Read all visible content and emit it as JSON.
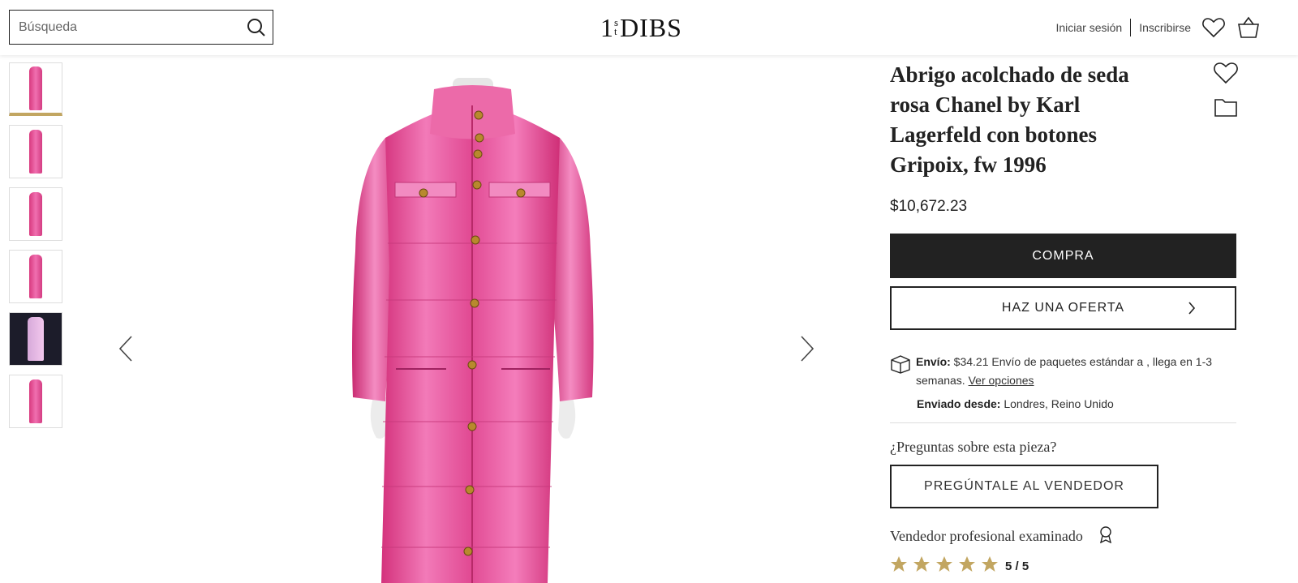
{
  "header": {
    "search_placeholder": "Búsqueda",
    "logo_number": "1",
    "logo_sup_s": "s",
    "logo_sup_t": "t",
    "logo_text": "DIBS",
    "login_label": "Iniciar sesión",
    "signup_label": "Inscribirse",
    "icons": [
      "search-icon",
      "heart-icon",
      "shopping-bag-icon"
    ]
  },
  "gallery": {
    "thumbnail_count": 6,
    "active_thumbnail": 1,
    "main_image_alt": "pink quilted silk coat on mannequin",
    "accent_color": "#c2a661",
    "icons": [
      "chevron-left-icon",
      "chevron-right-icon"
    ]
  },
  "product": {
    "title": "Abrigo acolchado de seda rosa Chanel by Karl Lagerfeld con botones Gripoix, fw 1996",
    "price": "$10,672.23",
    "buy_label": "COMPRA",
    "offer_label": "HAZ UNA OFERTA",
    "icons": [
      "heart-icon",
      "folder-icon",
      "box-icon",
      "chevron-right-icon",
      "award-icon",
      "star-icon"
    ]
  },
  "shipping": {
    "label": "Envío:",
    "text": " $34.21 Envío de paquetes estándar a , llega en 1-3 semanas. ",
    "options_link": "Ver opciones",
    "from_label": "Enviado desde:",
    "from_value": " Londres, Reino Unido"
  },
  "seller": {
    "questions": "¿Preguntas sobre esta pieza?",
    "ask_label": "PREGÚNTALE AL VENDEDOR",
    "vetted": "Vendedor profesional examinado",
    "rating": 5,
    "rating_text": "5 / 5",
    "star_color": "#c2a661"
  }
}
